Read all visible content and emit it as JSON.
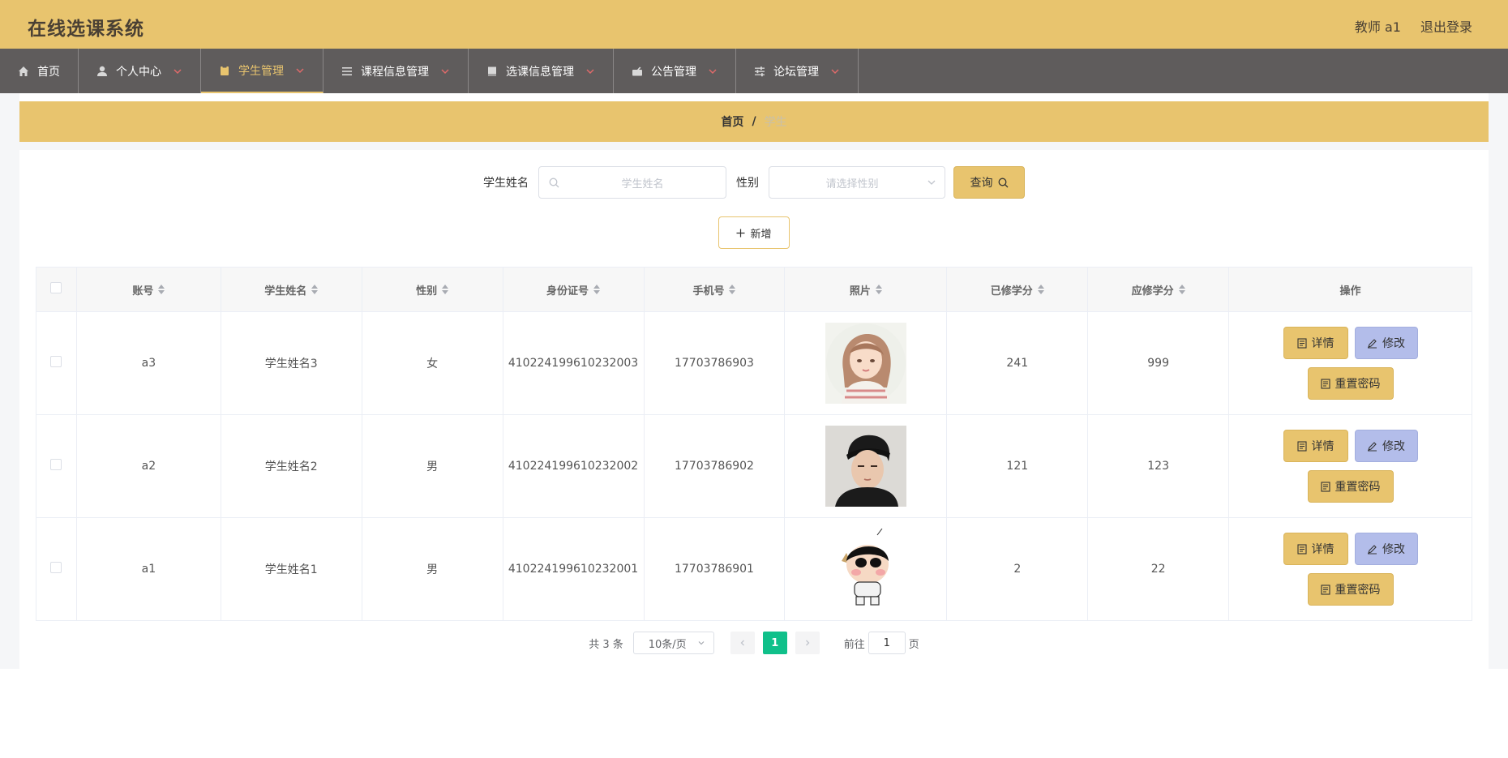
{
  "header": {
    "app_title": "在线选课系统",
    "user_label": "教师 a1",
    "logout_label": "退出登录"
  },
  "nav": {
    "items": [
      {
        "label": "首页",
        "icon": "home-icon"
      },
      {
        "label": "个人中心",
        "icon": "user-icon"
      },
      {
        "label": "学生管理",
        "icon": "clipboard-icon",
        "active": true
      },
      {
        "label": "课程信息管理",
        "icon": "list-icon"
      },
      {
        "label": "选课信息管理",
        "icon": "book-icon"
      },
      {
        "label": "公告管理",
        "icon": "megaphone-icon"
      },
      {
        "label": "论坛管理",
        "icon": "sliders-icon"
      }
    ]
  },
  "breadcrumb": {
    "home": "首页",
    "separator": "/",
    "current": "学生"
  },
  "search": {
    "name_label": "学生姓名",
    "name_placeholder": "学生姓名",
    "gender_label": "性别",
    "gender_placeholder": "请选择性别",
    "query_label": "查询"
  },
  "actions": {
    "add_label": "新增"
  },
  "table": {
    "columns": [
      "账号",
      "学生姓名",
      "性别",
      "身份证号",
      "手机号",
      "照片",
      "已修学分",
      "应修学分",
      "操作"
    ],
    "rows": [
      {
        "account": "a3",
        "name": "学生姓名3",
        "gender": "女",
        "id_card": "410224199610232003",
        "phone": "17703786903",
        "photo": "girl-portrait",
        "earned": "241",
        "required": "999"
      },
      {
        "account": "a2",
        "name": "学生姓名2",
        "gender": "男",
        "id_card": "410224199610232002",
        "phone": "17703786902",
        "photo": "boy-portrait",
        "earned": "121",
        "required": "123"
      },
      {
        "account": "a1",
        "name": "学生姓名1",
        "gender": "男",
        "id_card": "410224199610232001",
        "phone": "17703786901",
        "photo": "cartoon-portrait",
        "earned": "2",
        "required": "22"
      }
    ],
    "op_detail": "详情",
    "op_edit": "修改",
    "op_reset": "重置密码"
  },
  "pagination": {
    "total": "共 3 条",
    "page_size": "10条/页",
    "current_page": "1",
    "goto_label": "前往",
    "goto_value": "1",
    "page_suffix": "页"
  },
  "colors": {
    "accent": "#e8c46e",
    "nav_bg": "#5f5c5c",
    "edit_btn": "#b3bdea",
    "page_active": "#10c08a"
  }
}
